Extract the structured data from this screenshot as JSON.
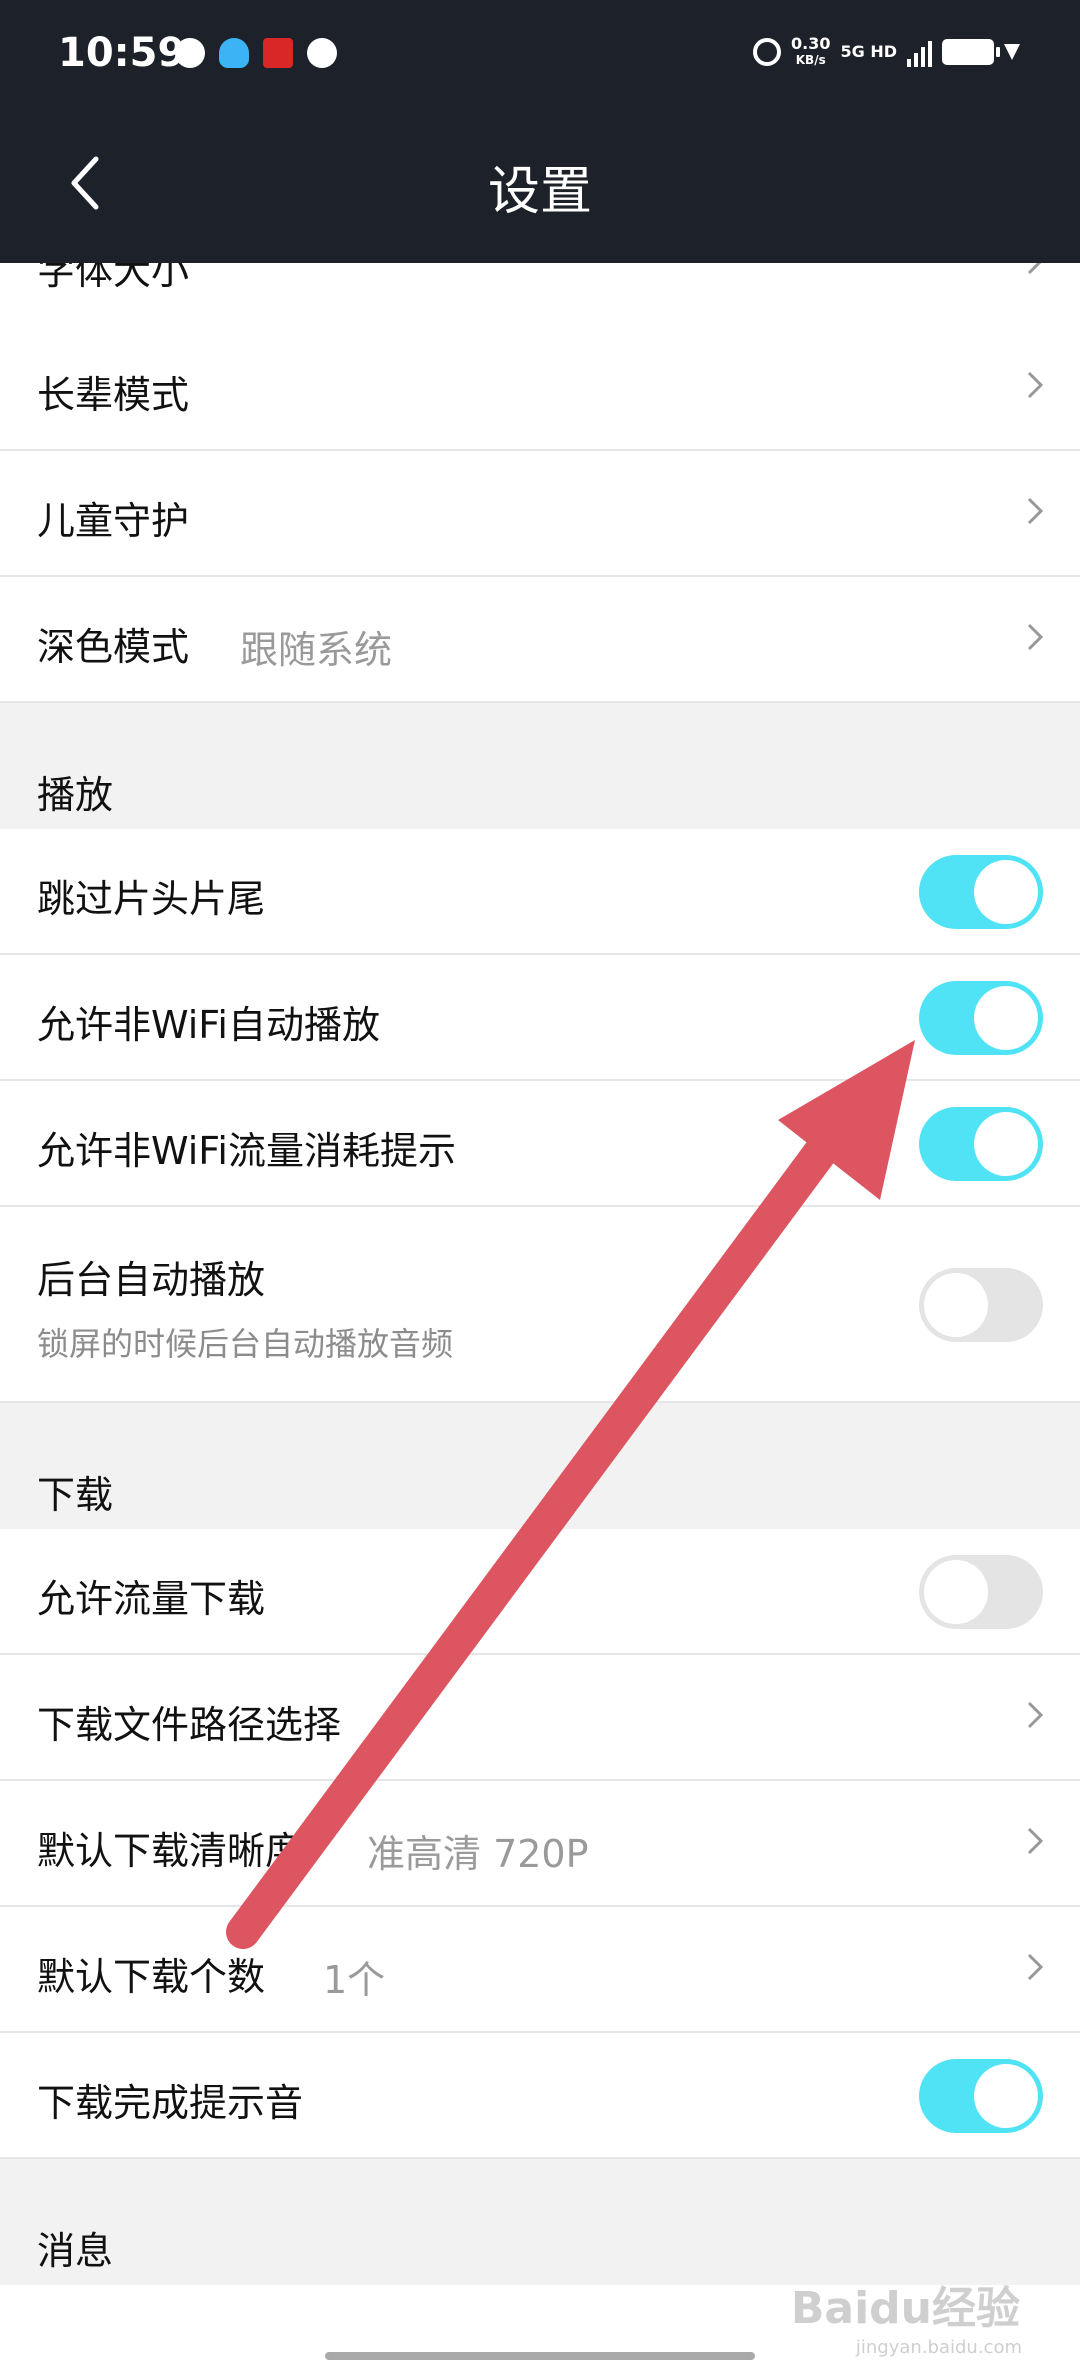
{
  "status_bar": {
    "time": "10:59",
    "notifications": [
      "wechat-icon",
      "qq-icon",
      "taobao-icon",
      "message-icon"
    ],
    "net_speed": "0.30",
    "net_speed_unit": "KB/s",
    "network_type": "5G HD"
  },
  "nav": {
    "title": "设置",
    "back_icon": "chevron-left-icon"
  },
  "general_items": [
    {
      "label": "字体大小"
    },
    {
      "label": "长辈模式"
    },
    {
      "label": "儿童守护"
    },
    {
      "label": "深色模式",
      "value": "跟随系统"
    }
  ],
  "sections": {
    "playback": "播放",
    "download": "下载",
    "message": "消息"
  },
  "playback_items": [
    {
      "label": "跳过片头片尾",
      "toggle": "on"
    },
    {
      "label": "允许非WiFi自动播放",
      "toggle": "on"
    },
    {
      "label": "允许非WiFi流量消耗提示",
      "toggle": "on"
    },
    {
      "label": "后台自动播放",
      "sublabel": "锁屏的时候后台自动播放音频",
      "toggle": "off"
    }
  ],
  "download_items": [
    {
      "label": "允许流量下载",
      "toggle": "off"
    },
    {
      "label": "下载文件路径选择"
    },
    {
      "label": "默认下载清晰度",
      "value": "准高清 720P"
    },
    {
      "label": "默认下载个数",
      "value": "1个"
    },
    {
      "label": "下载完成提示音",
      "toggle": "on"
    }
  ],
  "colors": {
    "accent_toggle": "#4fe3f5",
    "header_bg": "#1d2129",
    "annotation_arrow": "#dc5560"
  },
  "watermark": {
    "text": "Baidu经验",
    "sub": "jingyan.baidu.com"
  }
}
